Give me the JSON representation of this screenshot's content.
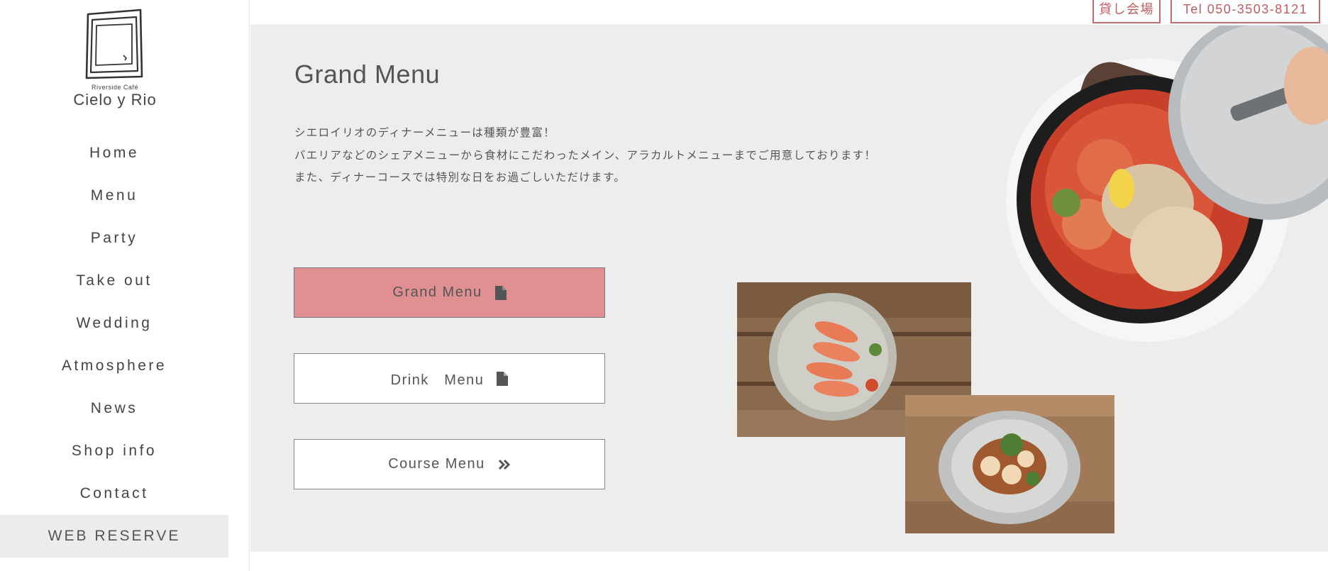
{
  "logo": {
    "subtitle": "Riverside Café",
    "name": "Cielo y Rio"
  },
  "nav": {
    "items": [
      {
        "label": "Home"
      },
      {
        "label": "Menu"
      },
      {
        "label": "Party"
      },
      {
        "label": "Take out"
      },
      {
        "label": "Wedding"
      },
      {
        "label": "Atmosphere"
      },
      {
        "label": "News"
      },
      {
        "label": "Shop info"
      },
      {
        "label": "Contact"
      }
    ],
    "reserve_label": "WEB RESERVE"
  },
  "topbar": {
    "hall_label": "貸し会場",
    "tel_label": "Tel 050-3503-8121"
  },
  "main": {
    "title": "Grand Menu",
    "description": [
      "シエロイリオのディナーメニューは種類が豊富！",
      "バエリアなどのシェアメニューから食材にこだわったメイン、アラカルトメニューまでご用意しております！",
      "また、ディナーコースでは特別な日をお過ごしいただけます。"
    ],
    "buttons": [
      {
        "label": "Grand Menu",
        "icon": "document-icon",
        "active": true
      },
      {
        "label": "Drink　Menu",
        "icon": "document-icon",
        "active": false
      },
      {
        "label": "Course Menu",
        "icon": "double-chevron-right-icon",
        "active": false
      }
    ]
  },
  "colors": {
    "accent": "#c25b62",
    "active_button": "#e09093",
    "panel_bg": "#ededed",
    "text": "#555555"
  }
}
